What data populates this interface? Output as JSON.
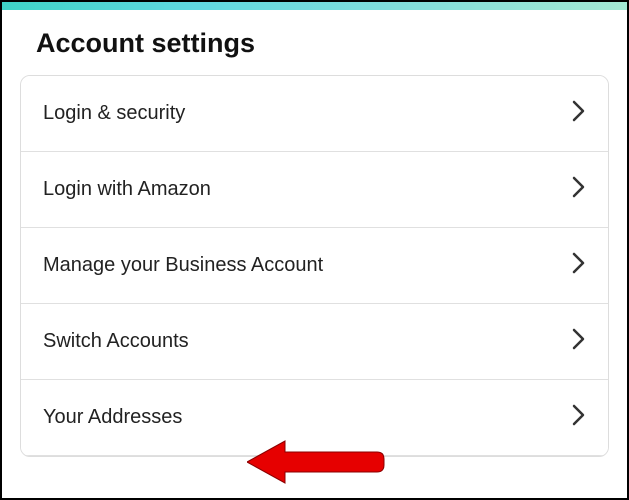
{
  "header": {
    "title": "Account settings"
  },
  "settings": {
    "items": [
      {
        "label": "Login & security"
      },
      {
        "label": "Login with Amazon"
      },
      {
        "label": "Manage your Business Account"
      },
      {
        "label": "Switch Accounts"
      },
      {
        "label": "Your Addresses"
      }
    ]
  }
}
